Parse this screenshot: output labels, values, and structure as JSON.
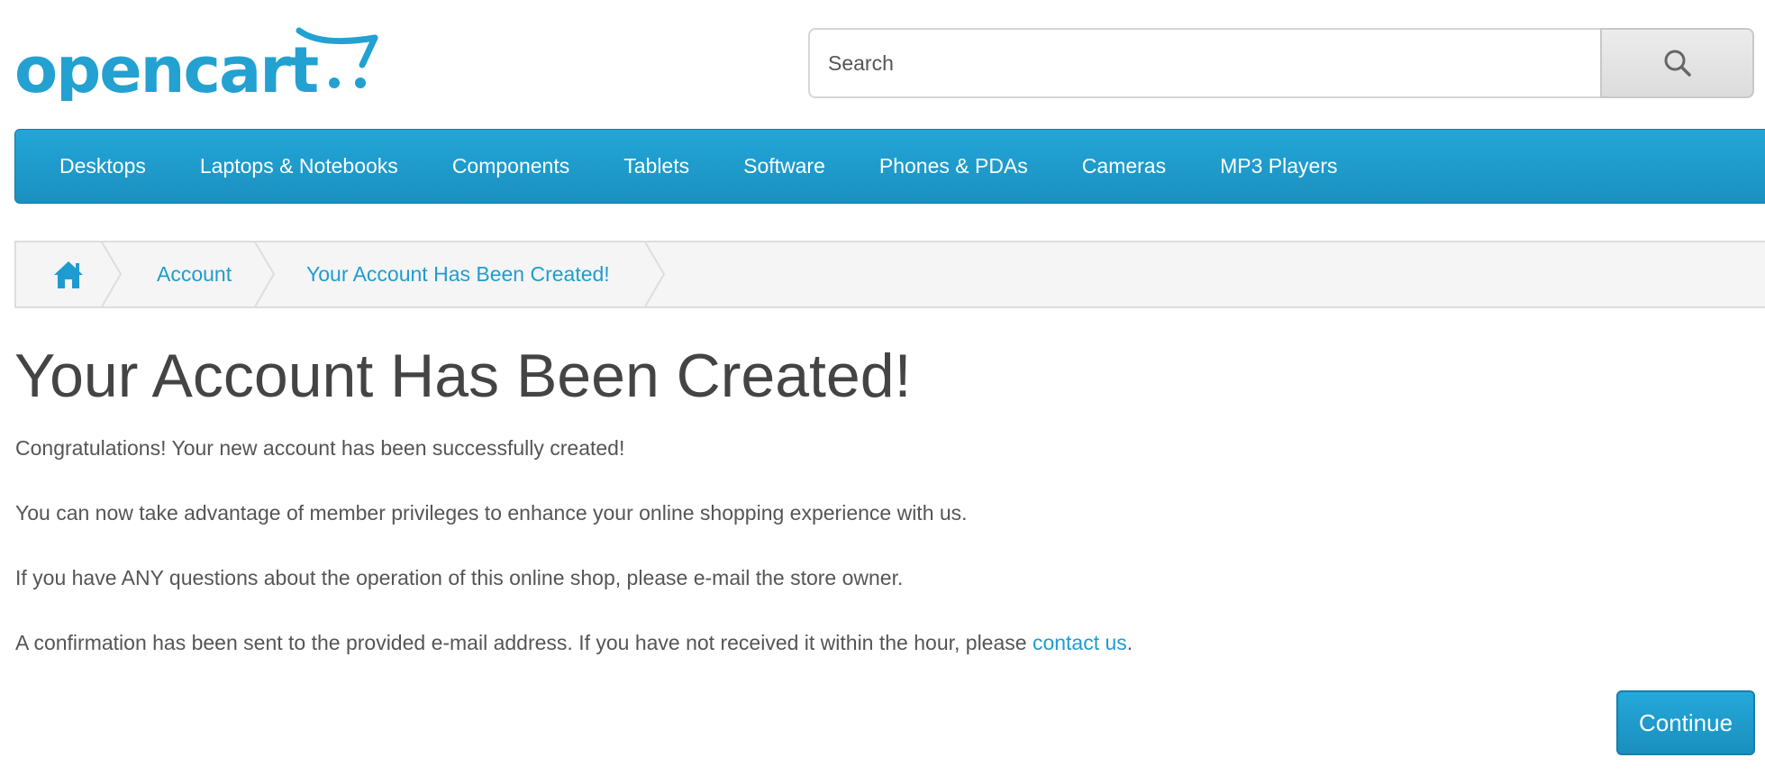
{
  "header": {
    "logo_text": "opencart",
    "logo_color": "#23a1d1",
    "search": {
      "placeholder": "Search",
      "button_icon": "search-icon"
    }
  },
  "menu": {
    "items": [
      {
        "label": "Desktops"
      },
      {
        "label": "Laptops & Notebooks"
      },
      {
        "label": "Components"
      },
      {
        "label": "Tablets"
      },
      {
        "label": "Software"
      },
      {
        "label": "Phones & PDAs"
      },
      {
        "label": "Cameras"
      },
      {
        "label": "MP3 Players"
      }
    ],
    "background_color": "#229ac8"
  },
  "breadcrumb": {
    "home_icon": "home-icon",
    "items": [
      {
        "label": "Account"
      },
      {
        "label": "Your Account Has Been Created!"
      }
    ]
  },
  "content": {
    "title": "Your Account Has Been Created!",
    "paragraphs": [
      "Congratulations! Your new account has been successfully created!",
      "You can now take advantage of member privileges to enhance your online shopping experience with us.",
      "If you have ANY questions about the operation of this online shop, please e-mail the store owner."
    ],
    "confirmation": {
      "text_before": "A confirmation has been sent to the provided e-mail address. If you have not received it within the hour, please ",
      "link_label": "contact us",
      "text_after": "."
    },
    "continue_label": "Continue",
    "link_color": "#1f9ccf"
  }
}
